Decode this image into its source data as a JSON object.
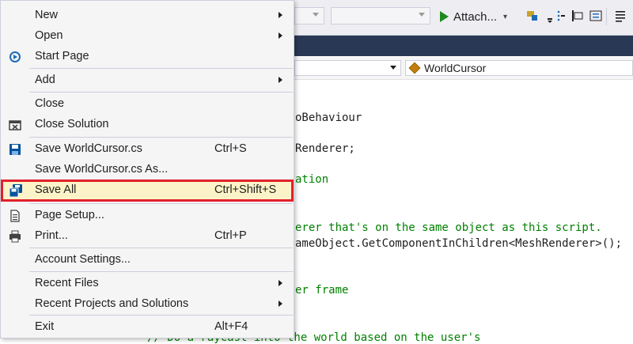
{
  "toolbar": {
    "attach_label": "Attach...",
    "attach_dropdown": "▾"
  },
  "navbar": {
    "member_label": "WorldCursor"
  },
  "code": {
    "lines": [
      "oBehaviour",
      "Renderer;",
      "ation",
      "erer that's on the same object as this script.",
      "ameObject.GetComponentInChildren<MeshRenderer>();",
      "er frame",
      "// Do a raycast into the world based on the user's"
    ]
  },
  "menu": {
    "items": [
      {
        "label": "New",
        "submenu": true
      },
      {
        "label": "Open",
        "submenu": true
      },
      {
        "label": "Start Page",
        "icon": "start-page-icon"
      },
      {
        "label": "Add",
        "submenu": true
      },
      {
        "label": "Close"
      },
      {
        "label": "Close Solution",
        "icon": "close-solution-icon"
      },
      {
        "label": "Save WorldCursor.cs",
        "shortcut": "Ctrl+S",
        "icon": "save-icon"
      },
      {
        "label": "Save WorldCursor.cs As..."
      },
      {
        "label": "Save All",
        "shortcut": "Ctrl+Shift+S",
        "icon": "save-all-icon",
        "highlighted": true
      },
      {
        "label": "Page Setup...",
        "icon": "page-setup-icon"
      },
      {
        "label": "Print...",
        "shortcut": "Ctrl+P",
        "icon": "print-icon"
      },
      {
        "label": "Account Settings..."
      },
      {
        "label": "Recent Files",
        "submenu": true
      },
      {
        "label": "Recent Projects and Solutions",
        "submenu": true
      },
      {
        "label": "Exit",
        "shortcut": "Alt+F4"
      }
    ]
  },
  "colors": {
    "highlight_outline": "#e1212b",
    "highlight_fill": "#fcf4c8",
    "tab_strip": "#293955",
    "comment": "#008000"
  }
}
